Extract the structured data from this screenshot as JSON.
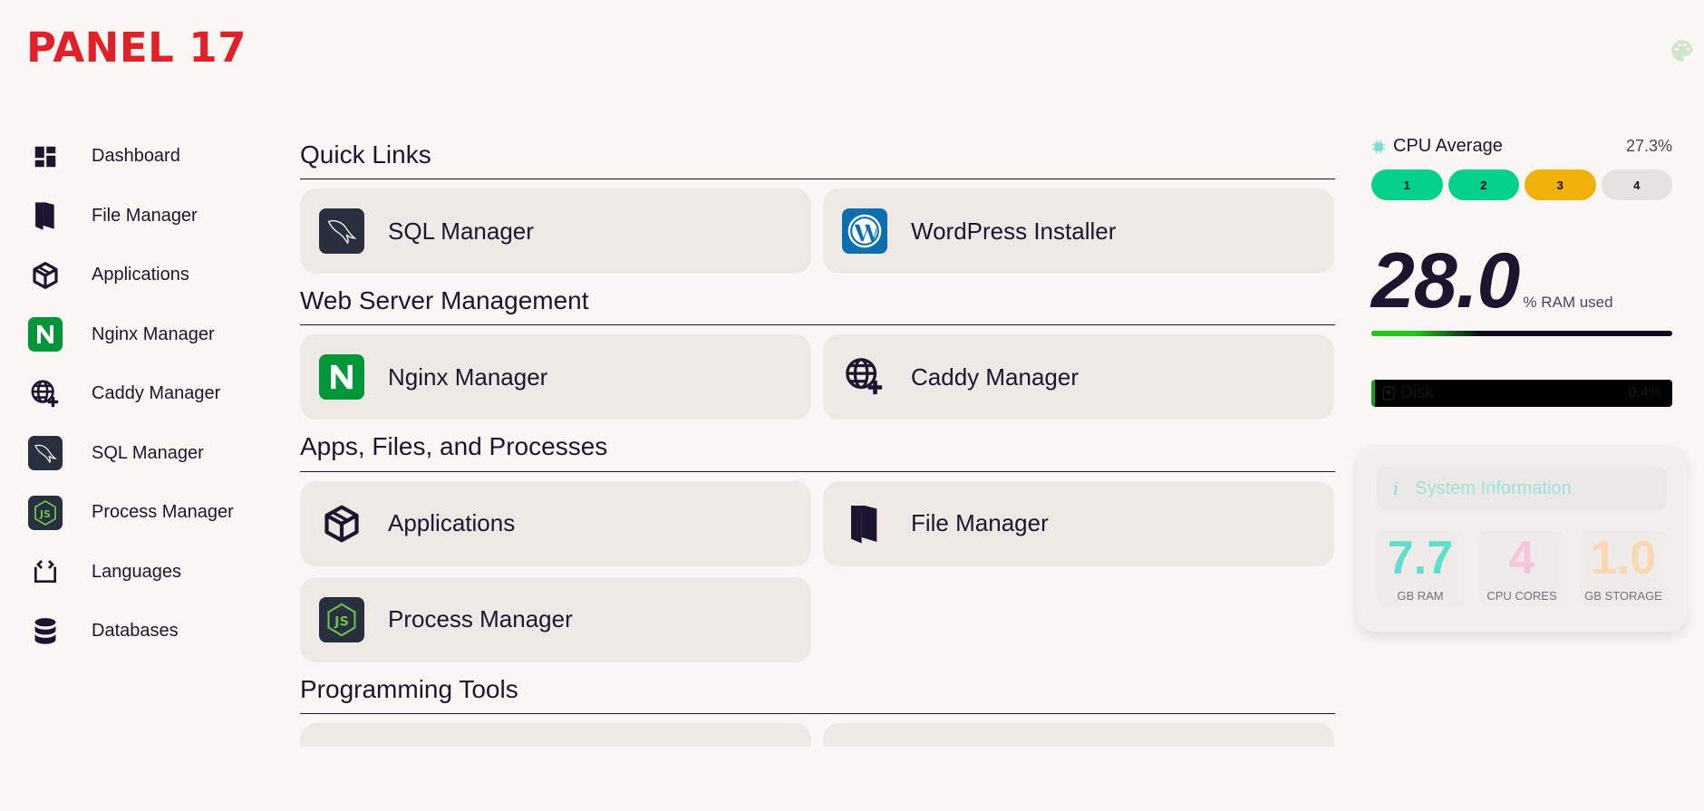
{
  "brand": {
    "logo": "PANEL 17",
    "color": "#e2202a"
  },
  "top": {
    "theme_icon": "palette-icon"
  },
  "sidebar": {
    "items": [
      {
        "label": "Dashboard",
        "icon": "dashboard-icon"
      },
      {
        "label": "File Manager",
        "icon": "file-manager-icon"
      },
      {
        "label": "Applications",
        "icon": "box-icon"
      },
      {
        "label": "Nginx Manager",
        "icon": "nginx-icon"
      },
      {
        "label": "Caddy Manager",
        "icon": "globe-plus-icon"
      },
      {
        "label": "SQL Manager",
        "icon": "mysql-dolphin-icon"
      },
      {
        "label": "Process Manager",
        "icon": "nodejs-icon"
      },
      {
        "label": "Languages",
        "icon": "code-icon"
      },
      {
        "label": "Databases",
        "icon": "database-icon"
      }
    ]
  },
  "main": {
    "sections": [
      {
        "title": "Quick Links",
        "cards": [
          {
            "label": "SQL Manager",
            "icon": "mysql-dolphin-icon"
          },
          {
            "label": "WordPress Installer",
            "icon": "wordpress-icon"
          }
        ]
      },
      {
        "title": "Web Server Management",
        "cards": [
          {
            "label": "Nginx Manager",
            "icon": "nginx-icon"
          },
          {
            "label": "Caddy Manager",
            "icon": "globe-plus-icon"
          }
        ]
      },
      {
        "title": "Apps, Files, and Processes",
        "cards": [
          {
            "label": "Applications",
            "icon": "box-icon"
          },
          {
            "label": "File Manager",
            "icon": "file-manager-icon"
          },
          {
            "label": "Process Manager",
            "icon": "nodejs-icon"
          }
        ]
      },
      {
        "title": "Programming Tools"
      }
    ]
  },
  "stats": {
    "cpu": {
      "label": "CPU Average",
      "percent": "27.3%",
      "cores": [
        {
          "label": "1",
          "color": "#05d18c"
        },
        {
          "label": "2",
          "color": "#05d18c"
        },
        {
          "label": "3",
          "color": "#f0b20a"
        },
        {
          "label": "4",
          "color": "#e6e2df"
        }
      ]
    },
    "ram": {
      "value": "28.0",
      "unit": "% RAM used",
      "fraction": 0.28
    },
    "disk": {
      "label": "Disk",
      "percent": "0.4%"
    },
    "system_info": {
      "title": "System Information",
      "items": [
        {
          "value": "7.7",
          "label": "GB RAM",
          "color": "#5fe0cf"
        },
        {
          "value": "4",
          "label": "CPU CORES",
          "color": "#f7c4dd"
        },
        {
          "value": "1.0",
          "label": "GB STORAGE",
          "color": "#fcd7b4"
        }
      ]
    }
  }
}
